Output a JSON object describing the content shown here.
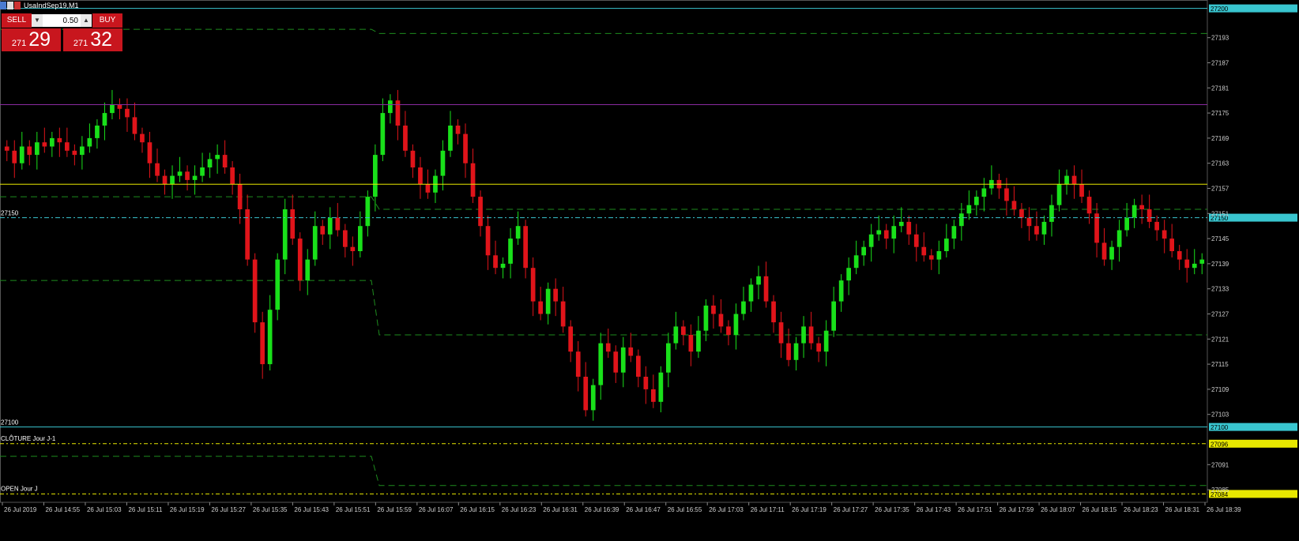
{
  "window": {
    "title": "UsaIndSep19,M1"
  },
  "trade_panel": {
    "sell_label": "SELL",
    "buy_label": "BUY",
    "lot_value": "0.50",
    "sell_price_small": "271",
    "sell_price_big": "29",
    "buy_price_small": "271",
    "buy_price_big": "32",
    "dec_icon": "triangle-down-icon",
    "inc_icon": "triangle-up-icon"
  },
  "chart_data": {
    "type": "candlestick",
    "ylim": [
      27082,
      27202
    ],
    "y_ticks": [
      "27193",
      "27187",
      "27181",
      "27175",
      "27169",
      "27163",
      "27157",
      "27151",
      "27145",
      "27139",
      "27133",
      "27127",
      "27121",
      "27115",
      "27109",
      "27103",
      "27091",
      "27085"
    ],
    "x_ticks": [
      "26 Jul 2019",
      "26 Jul 14:55",
      "26 Jul 15:03",
      "26 Jul 15:11",
      "26 Jul 15:19",
      "26 Jul 15:27",
      "26 Jul 15:35",
      "26 Jul 15:43",
      "26 Jul 15:51",
      "26 Jul 15:59",
      "26 Jul 16:07",
      "26 Jul 16:15",
      "26 Jul 16:23",
      "26 Jul 16:31",
      "26 Jul 16:39",
      "26 Jul 16:47",
      "26 Jul 16:55",
      "26 Jul 17:03",
      "26 Jul 17:11",
      "26 Jul 17:19",
      "26 Jul 17:27",
      "26 Jul 17:35",
      "26 Jul 17:43",
      "26 Jul 17:51",
      "26 Jul 17:59",
      "26 Jul 18:07",
      "26 Jul 18:15",
      "26 Jul 18:23",
      "26 Jul 18:31",
      "26 Jul 18:39"
    ],
    "closes": [
      27166,
      27163,
      27167,
      27165,
      27168,
      27167,
      27169,
      27168,
      27166,
      27165,
      27167,
      27169,
      27172,
      27175,
      27177,
      27176,
      27174,
      27170,
      27168,
      27163,
      27160,
      27158,
      27160,
      27161,
      27159,
      27160,
      27162,
      27164,
      27165,
      27162,
      27158,
      27152,
      27140,
      27125,
      27115,
      27128,
      27140,
      27152,
      27145,
      27135,
      27140,
      27148,
      27146,
      27150,
      27147,
      27143,
      27142,
      27148,
      27155,
      27165,
      27175,
      27178,
      27172,
      27166,
      27162,
      27158,
      27156,
      27160,
      27166,
      27172,
      27170,
      27163,
      27155,
      27148,
      27141,
      27138,
      27139,
      27145,
      27148,
      27138,
      27130,
      27127,
      27133,
      27130,
      27124,
      27118,
      27112,
      27104,
      27110,
      27120,
      27118,
      27113,
      27119,
      27117,
      27112,
      27109,
      27106,
      27113,
      27120,
      27124,
      27122,
      27118,
      27123,
      27129,
      27127,
      27124,
      27122,
      27127,
      27130,
      27134,
      27136,
      27130,
      27125,
      27120,
      27116,
      27120,
      27124,
      27120,
      27118,
      27123,
      27130,
      27135,
      27138,
      27141,
      27143,
      27146,
      27147,
      27145,
      27148,
      27149,
      27146,
      27143,
      27141,
      27140,
      27142,
      27145,
      27148,
      27151,
      27153,
      27155,
      27157,
      27159,
      27157,
      27154,
      27152,
      27150,
      27148,
      27146,
      27149,
      27153,
      27158,
      27160,
      27158,
      27155,
      27151,
      27144,
      27140,
      27143,
      27147,
      27150,
      27153,
      27152,
      27149,
      27147,
      27145,
      27142,
      27140,
      27138,
      27139,
      27140
    ],
    "hlines": [
      {
        "value": 27200,
        "label": "27200",
        "color": "#39c5cf"
      },
      {
        "value": 27150,
        "label": "27150",
        "color": "#39c5cf"
      },
      {
        "value": 27100,
        "label": "27100",
        "color": "#39c5cf"
      },
      {
        "value": 27096,
        "label": "27096",
        "color": "#e8e800"
      },
      {
        "value": 27084,
        "label": "27084",
        "color": "#e8e800"
      }
    ],
    "line_labels": {
      "close_prev_day": "CLÔTURE Jour J-1",
      "open_today": "OPEN Jour J"
    },
    "left_labels": [
      "27150",
      "27100"
    ],
    "colors": {
      "bull": "#19e01a",
      "bear": "#e0141a",
      "cyan": "#39c5cf",
      "purple": "#8a2aa0",
      "yellow": "#e8e800",
      "green_dash": "#1e8c1e",
      "axis_text": "#d0d0d0",
      "background": "#000000"
    }
  }
}
